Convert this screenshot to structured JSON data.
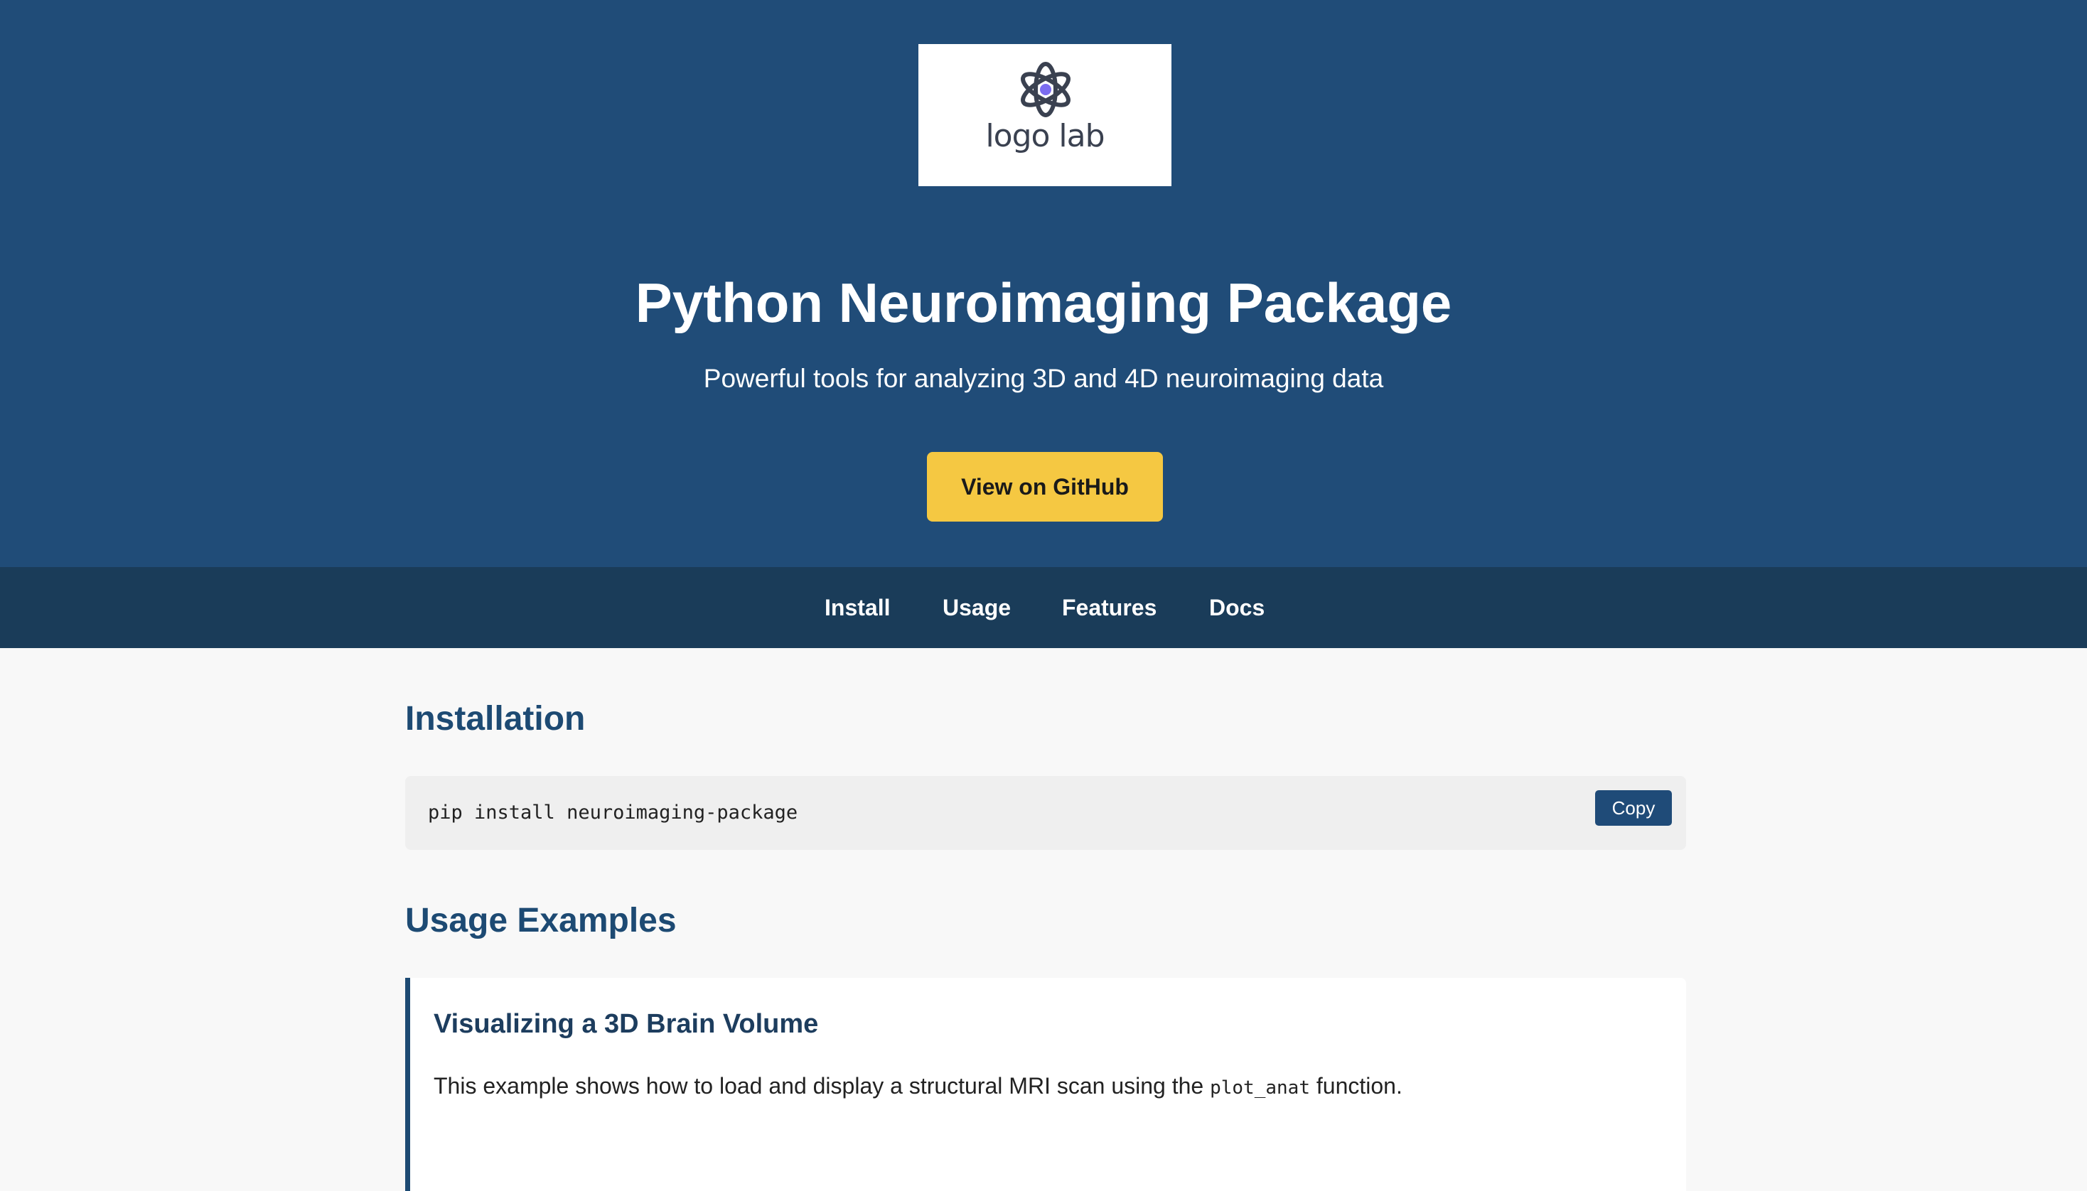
{
  "colors": {
    "hero_bg": "#204c78",
    "nav_bg": "#1a3c59",
    "accent_yellow": "#f5c842",
    "heading_blue": "#1d4a73",
    "page_bg": "#f8f8f8"
  },
  "header": {
    "logo_text": "logo lab",
    "logo_icon": "atom-icon",
    "title": "Python Neuroimaging Package",
    "subtitle": "Powerful tools for analyzing 3D and 4D neuroimaging data",
    "github_button": "View on GitHub"
  },
  "nav": {
    "items": [
      {
        "label": "Install"
      },
      {
        "label": "Usage"
      },
      {
        "label": "Features"
      },
      {
        "label": "Docs"
      }
    ]
  },
  "installation": {
    "heading": "Installation",
    "command": "pip install neuroimaging-package",
    "copy_label": "Copy"
  },
  "usage": {
    "heading": "Usage Examples",
    "example": {
      "title": "Visualizing a 3D Brain Volume",
      "desc_before": "This example shows how to load and display a structural MRI scan using the ",
      "desc_code": "plot_anat",
      "desc_after": " function."
    }
  }
}
